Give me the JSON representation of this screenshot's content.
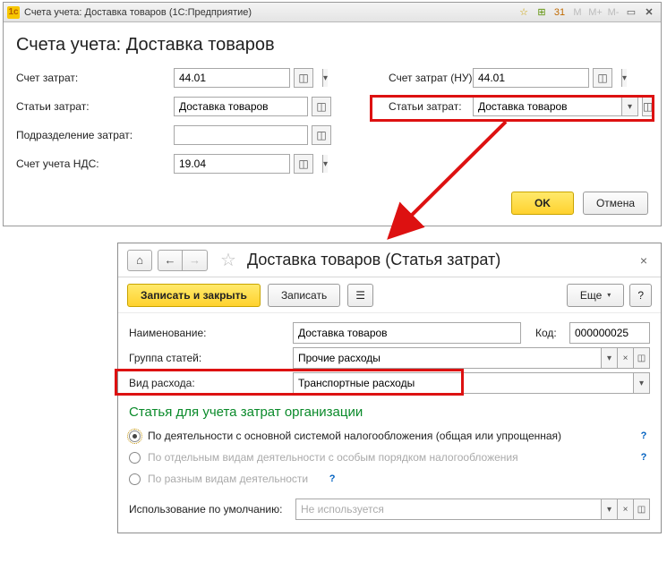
{
  "win1": {
    "titlebar": "Счета учета: Доставка товаров  (1С:Предприятие)",
    "heading": "Счета учета: Доставка товаров",
    "labels": {
      "cost_account": "Счет затрат:",
      "cost_items": "Статьи затрат:",
      "subdivision": "Подразделение затрат:",
      "vat_account": "Счет учета НДС:",
      "cost_account_nu": "Счет затрат (НУ):",
      "cost_items_nu": "Статьи затрат:"
    },
    "values": {
      "cost_account": "44.01",
      "cost_items": "Доставка товаров",
      "subdivision": "",
      "vat_account": "19.04",
      "cost_account_nu": "44.01",
      "cost_items_nu": "Доставка товаров"
    },
    "buttons": {
      "ok": "OK",
      "cancel": "Отмена"
    },
    "m_buttons": {
      "m": "M",
      "mplus": "M+",
      "mminus": "M-"
    }
  },
  "win2": {
    "title": "Доставка товаров (Статья затрат)",
    "toolbar": {
      "save_close": "Записать и закрыть",
      "save": "Записать",
      "more": "Еще",
      "help": "?"
    },
    "labels": {
      "name": "Наименование:",
      "code": "Код:",
      "group": "Группа статей:",
      "expense_type": "Вид расхода:",
      "section": "Статья для учета затрат организации",
      "radio1": "По деятельности с основной системой налогообложения (общая или упрощенная)",
      "radio2": "По отдельным видам деятельности с особым порядком налогообложения",
      "radio3": "По разным видам деятельности",
      "usage": "Использование по умолчанию:",
      "usage_placeholder": "Не используется"
    },
    "values": {
      "name": "Доставка товаров",
      "code": "000000025",
      "group": "Прочие расходы",
      "expense_type": "Транспортные расходы"
    }
  }
}
